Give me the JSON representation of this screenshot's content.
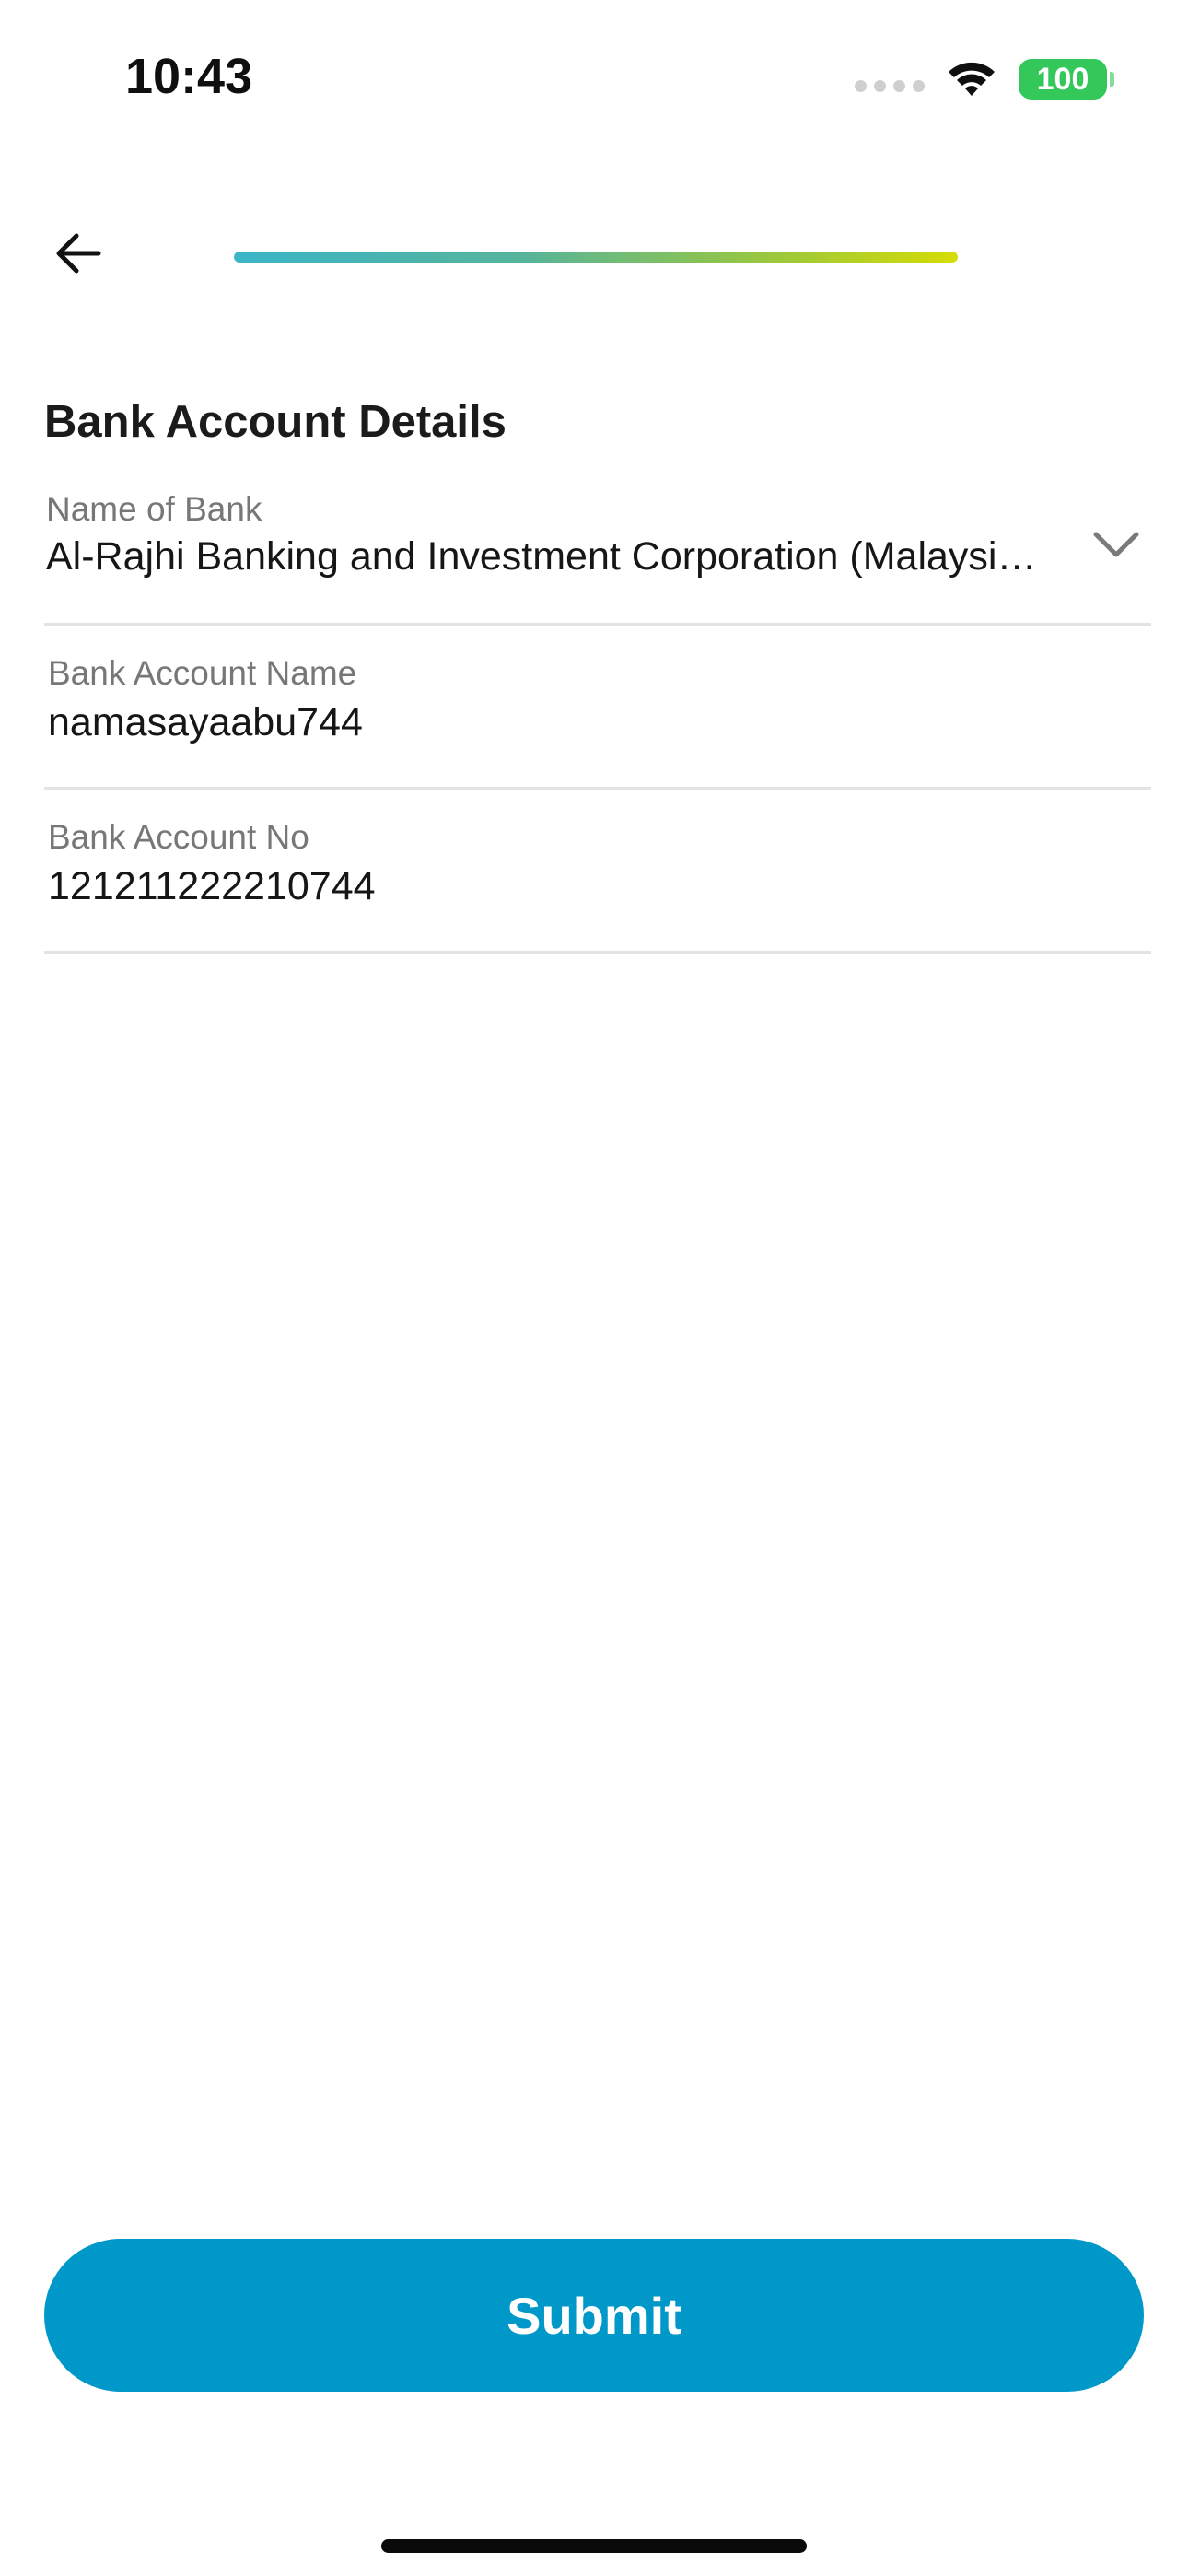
{
  "status_bar": {
    "time": "10:43",
    "battery": "100",
    "signal_icon": "cellular-signal-dots",
    "wifi_icon": "wifi-icon"
  },
  "header": {
    "back_icon": "arrow-left-icon",
    "progress_fraction": 1.0,
    "progress_gradient": [
      "#3bb5c8",
      "#9cc83b",
      "#d6dc05"
    ]
  },
  "form": {
    "title": "Bank Account Details",
    "bank": {
      "label": "Name of Bank",
      "value": "Al-Rajhi Banking and Investment Corporation (Malaysia) Berhad",
      "icon": "chevron-down-icon"
    },
    "account_name": {
      "label": "Bank Account Name",
      "value": "namasayaabu744"
    },
    "account_no": {
      "label": "Bank Account No",
      "value": "121211222210744"
    }
  },
  "actions": {
    "submit_label": "Submit",
    "submit_color": "#0097c9"
  },
  "colors": {
    "battery": "#34c759",
    "divider": "#e3e3e3",
    "label": "#777777"
  }
}
